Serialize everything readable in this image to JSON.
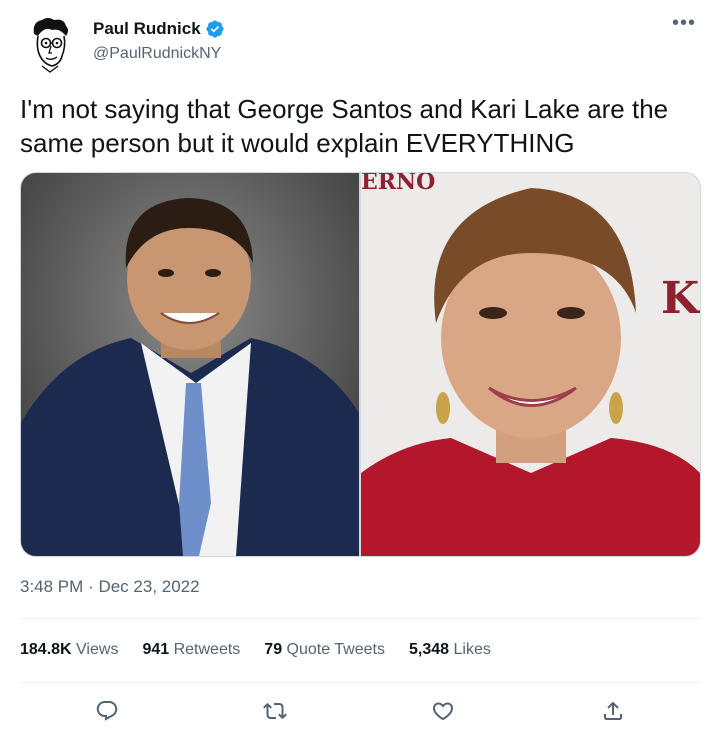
{
  "author": {
    "name": "Paul Rudnick",
    "handle": "@PaulRudnickNY",
    "verified": true
  },
  "tweet": {
    "text": "I'm not saying that George Santos and Kari Lake are the same person but it would explain EVERYTHING",
    "time": "3:48 PM",
    "separator": "·",
    "date": "Dec 23, 2022"
  },
  "media": {
    "photo_count": 2,
    "backdrop_text_top": "ERNO",
    "backdrop_text_right": "K."
  },
  "stats": {
    "views_count": "184.8K",
    "views_label": "Views",
    "retweets_count": "941",
    "retweets_label": "Retweets",
    "quotes_count": "79",
    "quotes_label": "Quote Tweets",
    "likes_count": "5,348",
    "likes_label": "Likes"
  },
  "actions": [
    "reply-icon",
    "retweet-icon",
    "like-icon",
    "share-icon"
  ],
  "colors": {
    "text_primary": "#0f1419",
    "text_secondary": "#536471",
    "verified_blue": "#1d9bf0",
    "divider": "#eff3f4"
  }
}
